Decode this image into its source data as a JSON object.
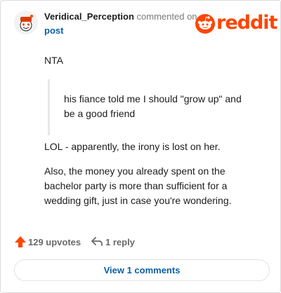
{
  "header": {
    "username": "Veridical_Perception",
    "commented_on": "commented on",
    "post_link": "post",
    "brand": "reddit"
  },
  "comment": {
    "line1": "NTA",
    "quote_line1": "his fiance told me I should \"grow up\" and",
    "quote_line2": "be a good friend",
    "line2": "LOL - apparently, the irony is lost on her.",
    "line3": "Also, the money you already spent on the bachelor party is more than sufficient for a wedding gift, just in case you're wondering."
  },
  "footer": {
    "upvotes": "129 upvotes",
    "reply": "1 reply",
    "view_comments": "View 1 comments"
  },
  "colors": {
    "brand": "#ff4500",
    "link": "#0a5fa6"
  },
  "icons": [
    "user-avatar",
    "reddit-logo",
    "upvote-arrow-icon",
    "reply-arrow-icon"
  ]
}
